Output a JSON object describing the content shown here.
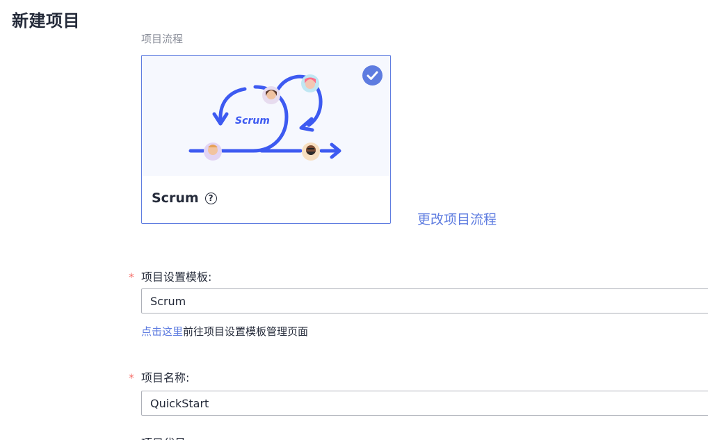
{
  "page": {
    "title": "新建项目"
  },
  "process": {
    "section_label": "项目流程",
    "card_name": "Scrum",
    "illustration_text": "Scrum",
    "change_link": "更改项目流程"
  },
  "template_field": {
    "required_mark": "*",
    "label": "项目设置模板:",
    "value": "Scrum",
    "hint_link": "点击这里",
    "hint_text": "前往项目设置模板管理页面"
  },
  "name_field": {
    "required_mark": "*",
    "label": "项目名称:",
    "value": "QuickStart"
  },
  "next_field": {
    "label": "项目代号"
  },
  "colors": {
    "accent": "#5e7ce0",
    "required": "#f66f6a",
    "illustration_blue": "#3d5af1"
  }
}
